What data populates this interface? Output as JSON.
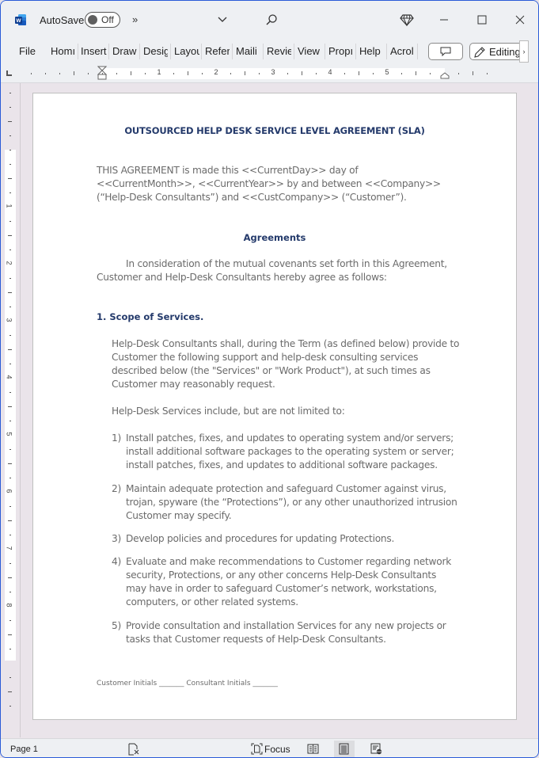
{
  "titlebar": {
    "autosave_label": "AutoSave",
    "autosave_state": "Off",
    "more_commands": "»"
  },
  "ribbon": {
    "tabs": [
      "File",
      "Home",
      "Insert",
      "Draw",
      "Design",
      "Layout",
      "References",
      "Mailings",
      "Review",
      "View",
      "Properties",
      "Help",
      "Acrobat"
    ],
    "tabs_visible": [
      "File",
      "Homı",
      "Insert",
      "Draw",
      "Desig",
      "Layou",
      "Refer",
      "Maili",
      "Revie",
      "View",
      "Propı",
      "Help",
      "Acrol"
    ],
    "editing_label": "Editing",
    "scroll_right": "›"
  },
  "ruler": {
    "h_numbers": [
      "1",
      "2",
      "3",
      "4",
      "5"
    ],
    "v_numbers": [
      "1",
      "2",
      "3",
      "4",
      "5",
      "6",
      "7",
      "8"
    ]
  },
  "document": {
    "title": "OUTSOURCED HELP DESK SERVICE LEVEL AGREEMENT (SLA)",
    "intro": "THIS AGREEMENT is made this <<CurrentDay>> day of <<CurrentMonth>>, <<CurrentYear>> by and between <<Company>> (“Help-Desk Consultants”) and <<CustCompany>> (“Customer”).",
    "agreements_heading": "Agreements",
    "consideration": "In consideration of the mutual covenants set forth in this Agreement, Customer and Help-Desk Consultants hereby agree as follows:",
    "scope_heading": "1. Scope of Services.",
    "scope_para": "Help-Desk Consultants shall, during the Term (as defined below) provide to Customer the following support and help-desk consulting services described below (the \"Services\" or \"Work Product\"), at such times as Customer may reasonably request.",
    "include_para": "Help-Desk Services include, but are not limited to:",
    "list": [
      {
        "num": "1)",
        "text": "Install patches, fixes, and updates to operating system and/or servers; install additional software packages to the operating system or server; install patches, fixes, and updates to additional software packages."
      },
      {
        "num": "2)",
        "text": "Maintain adequate protection and safeguard Customer against virus, trojan, spyware (the “Protections”), or any other unauthorized intrusion Customer may specify."
      },
      {
        "num": "3)",
        "text": "Develop policies and procedures for updating Protections."
      },
      {
        "num": "4)",
        "text": "Evaluate and make recommendations to Customer regarding network security, Protections, or any other concerns Help-Desk Consultants may have in order to safeguard Customer’s network, workstations, computers, or other related systems."
      },
      {
        "num": "5)",
        "text": "Provide consultation and installation Services for any new projects or tasks that Customer requests of Help-Desk Consultants."
      }
    ],
    "footer_initials": "Customer Initials _______ Consultant Initials _______"
  },
  "statusbar": {
    "page": "Page 1",
    "focus_label": "Focus"
  },
  "colors": {
    "heading": "#243a6b",
    "body_text": "#6b6b6b",
    "word_blue": "#185abd",
    "window_border": "#2a5bd7"
  }
}
